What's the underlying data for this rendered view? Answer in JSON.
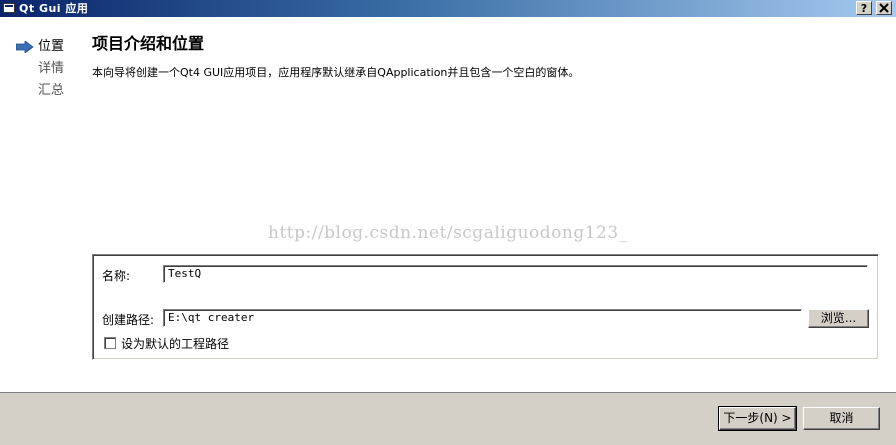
{
  "window": {
    "title": "Qt Gui 应用",
    "help_btn": "?",
    "close_btn": "X"
  },
  "nav": {
    "items": [
      {
        "label": "位置",
        "active": true
      },
      {
        "label": "详情",
        "active": false
      },
      {
        "label": "汇总",
        "active": false
      }
    ]
  },
  "page": {
    "title": "项目介绍和位置",
    "description": "本向导将创建一个Qt4 GUI应用项目，应用程序默认继承自QApplication并且包含一个空白的窗体。"
  },
  "watermark": "http://blog.csdn.net/scgaliguodong123_",
  "form": {
    "name_label": "名称:",
    "name_value": "TestQ",
    "path_label": "创建路径:",
    "path_value": "E:\\qt creater",
    "browse_label": "浏览...",
    "default_path_label": "设为默认的工程路径",
    "default_path_checked": false
  },
  "footer": {
    "next_label": "下一步(N) >",
    "cancel_label": "取消"
  },
  "colors": {
    "titlebar_start": "#0a246a",
    "titlebar_end": "#a6caf0",
    "nav_arrow": "#3d6fb5",
    "dialog_face": "#d4d0c8"
  }
}
